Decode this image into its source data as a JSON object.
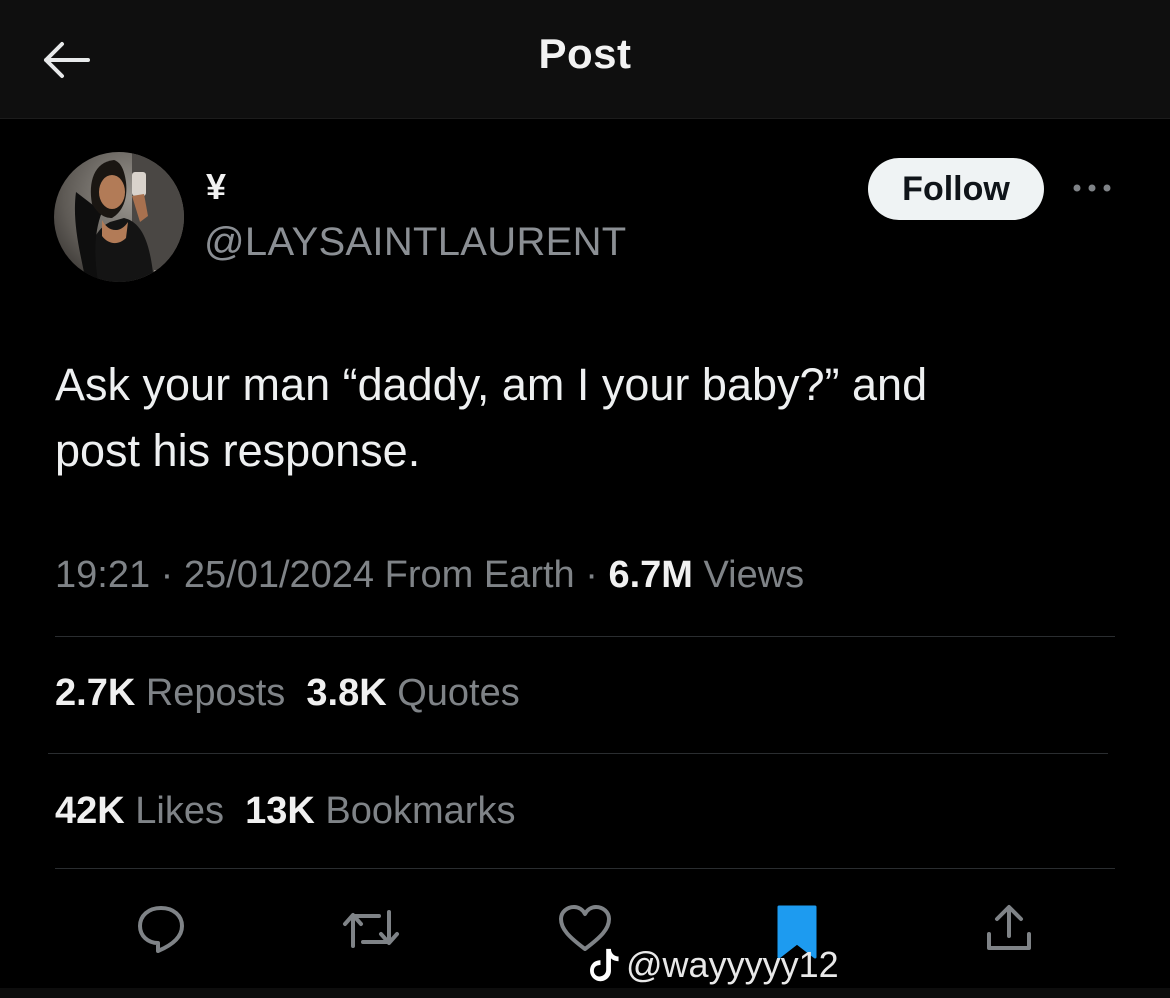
{
  "header": {
    "title": "Post"
  },
  "author": {
    "display_name": "¥",
    "handle": "@LAYSAINTLAURENT"
  },
  "follow_label": "Follow",
  "tweet": {
    "text_line1": "Ask your man “daddy, am I your baby?” and",
    "text_line2": "post his response."
  },
  "meta": {
    "time": "19:21",
    "sep1": "·",
    "date": "25/01/2024",
    "location": "From Earth",
    "sep2": "·",
    "views_count": "6.7M",
    "views_label": "Views"
  },
  "stats": {
    "reposts_count": "2.7K",
    "reposts_label": "Reposts",
    "quotes_count": "3.8K",
    "quotes_label": "Quotes",
    "likes_count": "42K",
    "likes_label": "Likes",
    "bookmarks_count": "13K",
    "bookmarks_label": "Bookmarks"
  },
  "watermark": {
    "text": "@wayyyyy12"
  },
  "colors": {
    "background": "#000000",
    "header_bg": "#0f0f0f",
    "muted_text": "#7f8387",
    "bookmark_blue": "#1d9bf0",
    "follow_bg": "#eff3f4"
  },
  "icons": {
    "back": "arrow-left-icon",
    "more": "more-horizontal-icon",
    "reply": "speech-bubble-icon",
    "repost": "repost-arrows-icon",
    "like": "heart-icon",
    "bookmark": "bookmark-filled-icon",
    "share": "share-upload-icon",
    "watermark": "tiktok-logo-icon"
  }
}
